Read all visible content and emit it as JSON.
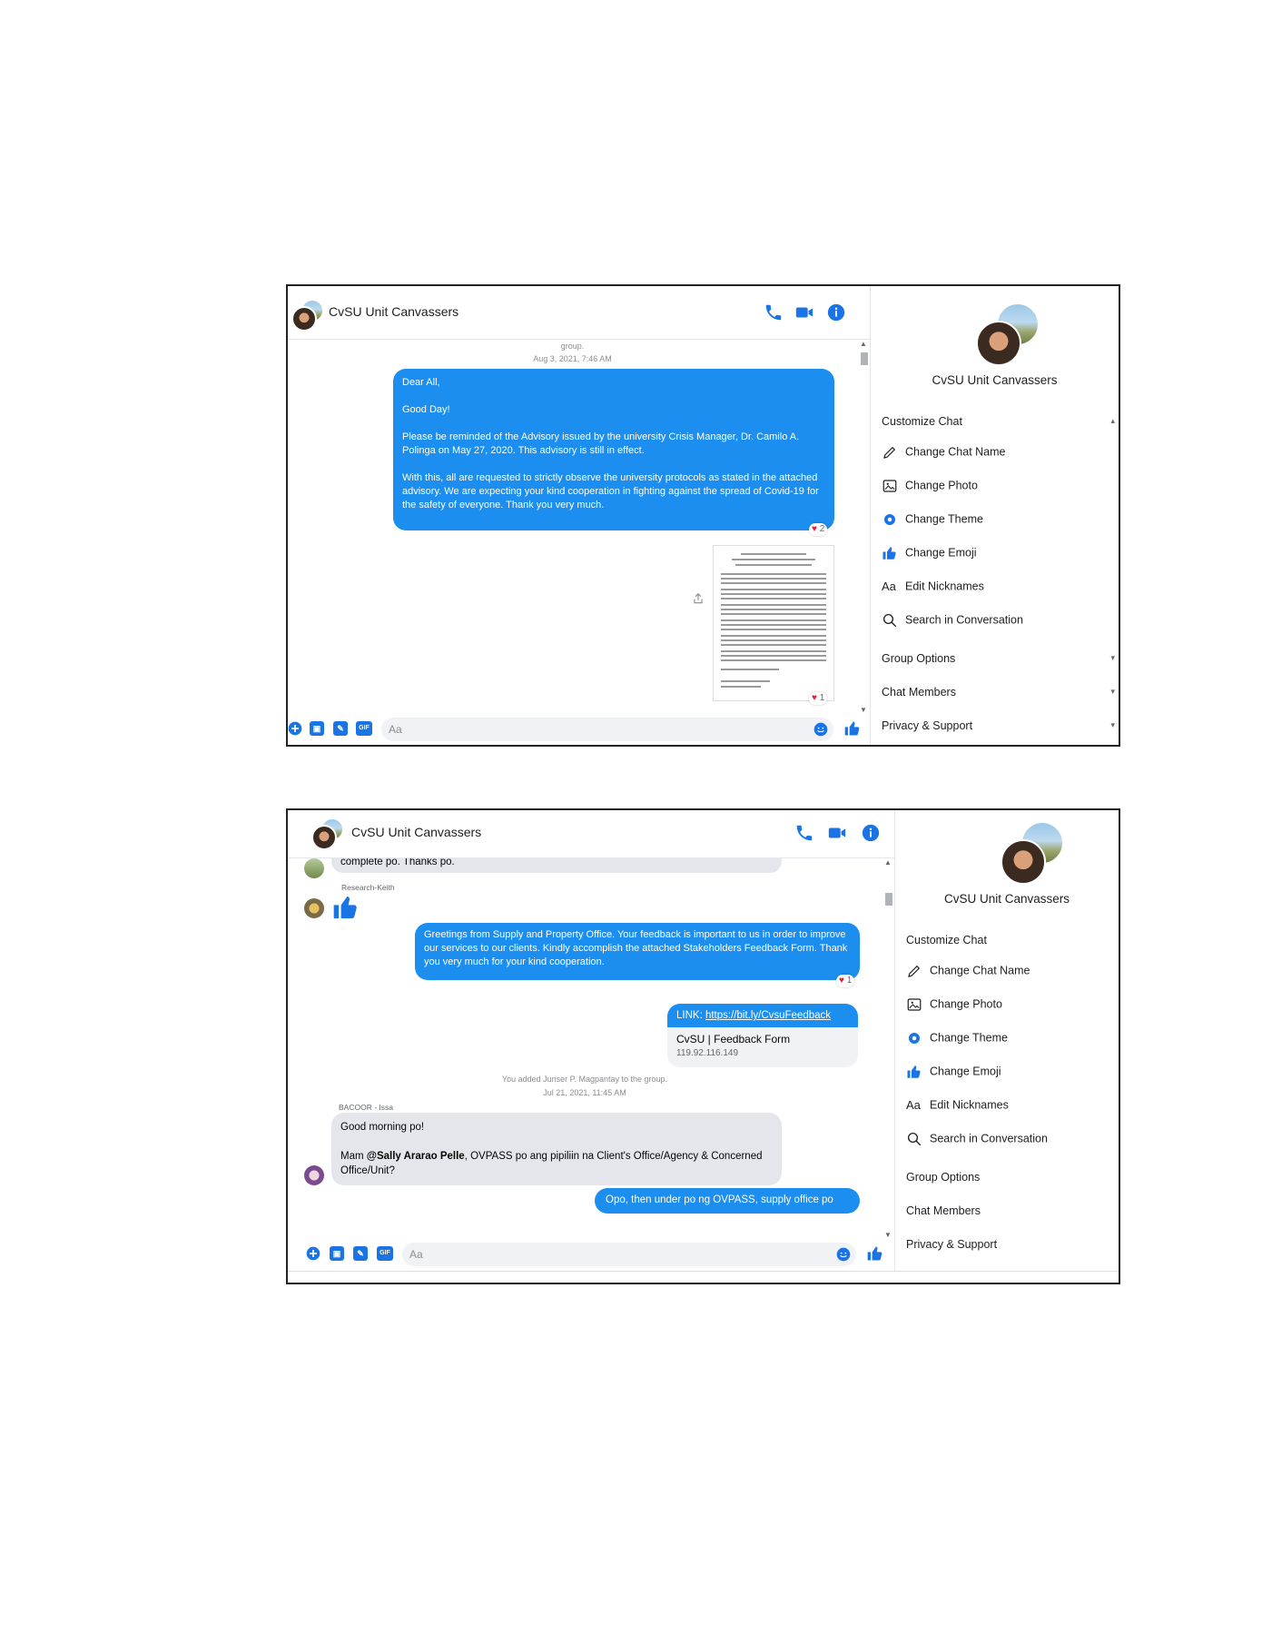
{
  "colors": {
    "accent": "#1b74e4",
    "bubble_blue": "#1b8eef",
    "bubble_gray": "#e4e6eb",
    "heart": "#e41e3f"
  },
  "chat_title": "CvSU Unit Canvassers",
  "header_icons": [
    "phone-icon",
    "video-icon",
    "info-icon"
  ],
  "composer": {
    "placeholder": "Aa",
    "icons": [
      "plus-icon",
      "photo-icon",
      "sticker-icon",
      "gif-icon",
      "emoji-icon",
      "like-icon"
    ],
    "gif_label": "GIF"
  },
  "sidebar": {
    "title": "CvSU Unit Canvassers",
    "customize_label": "Customize Chat",
    "items": [
      {
        "icon": "pencil-icon",
        "label": "Change Chat Name"
      },
      {
        "icon": "image-icon",
        "label": "Change Photo"
      },
      {
        "icon": "theme-icon",
        "label": "Change Theme"
      },
      {
        "icon": "thumbs-up-icon",
        "label": "Change Emoji"
      },
      {
        "icon": "text-aa-icon",
        "label": "Edit Nicknames",
        "glyph": "Aa"
      },
      {
        "icon": "search-icon",
        "label": "Search in Conversation"
      }
    ],
    "sections": [
      "Group Options",
      "Chat Members",
      "Privacy & Support"
    ]
  },
  "screen1": {
    "system_group": "group.",
    "timestamp": "Aug 3, 2021, 7:46 AM",
    "message": {
      "line1": "Dear All,",
      "line2": "Good Day!",
      "line3": "Please be reminded of the Advisory issued by the university Crisis Manager, Dr. Camilo A. Polinga on May 27, 2020. This advisory is still in effect.",
      "line4": "With this, all are requested to strictly observe the university protocols as stated in the attached advisory.  We are expecting your kind cooperation in fighting against the spread of Covid-19 for the safety of everyone.  Thank you very much.",
      "reaction_count": "2"
    },
    "attachment_reaction_count": "1"
  },
  "screen2": {
    "prev_message": "complete po. Thanks po.",
    "sender_keith": "Research-Keith",
    "supply_message": "Greetings from Supply and Property Office. Your feedback is important to us in order to improve our services to our clients.  Kindly accomplish the attached Stakeholders Feedback Form.  Thank you very much for your kind cooperation.",
    "supply_reaction_count": "1",
    "link_prefix": "LINK: ",
    "link_url": "https://bit.ly/CvsuFeedback",
    "card_title": "CvSU | Feedback Form",
    "card_sub": "119.92.116.149",
    "system_added": "You added Junser P. Magpantay to the group.",
    "timestamp": "Jul 21, 2021, 11:45 AM",
    "sender_bacoor": "BACOOR - Issa",
    "bacoor_line1": "Good morning po!",
    "bacoor_pre": "Mam ",
    "bacoor_mention": "@Sally Ararao Pelle",
    "bacoor_post": ", OVPASS po ang pipiliin na Client's Office/Agency & Concerned Office/Unit?",
    "reply": "Opo, then under po ng OVPASS, supply office po"
  }
}
